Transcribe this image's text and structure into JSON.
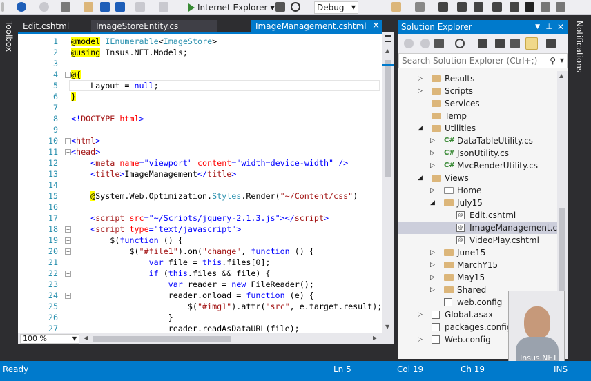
{
  "toolbar": {
    "run_label": "Internet Explorer",
    "config": "Debug"
  },
  "side_panels": {
    "left": "Toolbox",
    "right": "Notifications"
  },
  "tabs": [
    {
      "label": "Edit.cshtml"
    },
    {
      "label": "ImageStoreEntity.cs"
    },
    {
      "label": "ImageManagement.cshtml",
      "active": true
    }
  ],
  "editor": {
    "zoom": "100 %",
    "lines": [
      {
        "n": "1",
        "segs": [
          [
            "@model",
            "#000",
            "#ffff00"
          ],
          [
            " ",
            "#000"
          ],
          [
            "IEnumerable",
            "#2b91af"
          ],
          [
            "<",
            "#000"
          ],
          [
            "ImageStore",
            "#2b91af"
          ],
          [
            ">",
            "#000"
          ]
        ]
      },
      {
        "n": "2",
        "segs": [
          [
            "@using",
            "#000",
            "#ffff00"
          ],
          [
            " Insus.NET.Models;",
            "#000"
          ]
        ]
      },
      {
        "n": "3",
        "segs": []
      },
      {
        "n": "4",
        "fold": "-",
        "segs": [
          [
            "@{",
            "#000",
            "#ffff00"
          ]
        ]
      },
      {
        "n": "5",
        "cur": true,
        "segs": [
          [
            "    Layout = ",
            "#000"
          ],
          [
            "null",
            "#0000ff"
          ],
          [
            ";",
            "#000"
          ]
        ]
      },
      {
        "n": "6",
        "segs": [
          [
            "}",
            "#000",
            "#ffff00"
          ]
        ]
      },
      {
        "n": "7",
        "segs": []
      },
      {
        "n": "8",
        "segs": [
          [
            "<!",
            "#0000ff"
          ],
          [
            "DOCTYPE",
            "#a31515"
          ],
          [
            " ",
            "#000"
          ],
          [
            "html",
            "#ff0000"
          ],
          [
            ">",
            "#0000ff"
          ]
        ]
      },
      {
        "n": "9",
        "segs": []
      },
      {
        "n": "10",
        "fold": "-",
        "segs": [
          [
            "<",
            "#0000ff"
          ],
          [
            "html",
            "#a31515"
          ],
          [
            ">",
            "#0000ff"
          ]
        ]
      },
      {
        "n": "11",
        "fold": "-",
        "segs": [
          [
            "<",
            "#0000ff"
          ],
          [
            "head",
            "#a31515"
          ],
          [
            ">",
            "#0000ff"
          ]
        ]
      },
      {
        "n": "12",
        "segs": [
          [
            "    <",
            "#0000ff"
          ],
          [
            "meta",
            "#a31515"
          ],
          [
            " ",
            "#000"
          ],
          [
            "name",
            "#ff0000"
          ],
          [
            "=",
            "#0000ff"
          ],
          [
            "\"viewport\"",
            "#0000ff"
          ],
          [
            " ",
            "#000"
          ],
          [
            "content",
            "#ff0000"
          ],
          [
            "=",
            "#0000ff"
          ],
          [
            "\"width=device-width\"",
            "#0000ff"
          ],
          [
            " />",
            "#0000ff"
          ]
        ]
      },
      {
        "n": "13",
        "segs": [
          [
            "    <",
            "#0000ff"
          ],
          [
            "title",
            "#a31515"
          ],
          [
            ">",
            "#0000ff"
          ],
          [
            "ImageManagement",
            "#000"
          ],
          [
            "</",
            "#0000ff"
          ],
          [
            "title",
            "#a31515"
          ],
          [
            ">",
            "#0000ff"
          ]
        ]
      },
      {
        "n": "14",
        "segs": []
      },
      {
        "n": "15",
        "segs": [
          [
            "    ",
            "#000"
          ],
          [
            "@",
            "#000",
            "#ffff00"
          ],
          [
            "System.Web.Optimization.",
            "#000"
          ],
          [
            "Styles",
            "#2b91af"
          ],
          [
            ".Render(",
            "#000"
          ],
          [
            "\"~/Content/css\"",
            "#a31515"
          ],
          [
            ")",
            "#000"
          ]
        ]
      },
      {
        "n": "16",
        "segs": []
      },
      {
        "n": "17",
        "segs": [
          [
            "    <",
            "#0000ff"
          ],
          [
            "script",
            "#a31515"
          ],
          [
            " ",
            "#000"
          ],
          [
            "src",
            "#ff0000"
          ],
          [
            "=",
            "#0000ff"
          ],
          [
            "\"~/Scripts/jquery-2.1.3.js\"",
            "#0000ff"
          ],
          [
            "></",
            "#0000ff"
          ],
          [
            "script",
            "#a31515"
          ],
          [
            ">",
            "#0000ff"
          ]
        ]
      },
      {
        "n": "18",
        "fold": "-",
        "segs": [
          [
            "    <",
            "#0000ff"
          ],
          [
            "script",
            "#a31515"
          ],
          [
            " ",
            "#000"
          ],
          [
            "type",
            "#ff0000"
          ],
          [
            "=",
            "#0000ff"
          ],
          [
            "\"text/javascript\"",
            "#0000ff"
          ],
          [
            ">",
            "#0000ff"
          ]
        ]
      },
      {
        "n": "19",
        "fold": "-",
        "segs": [
          [
            "        $(",
            "#000"
          ],
          [
            "function",
            "#0000ff"
          ],
          [
            " () {",
            "#000"
          ]
        ]
      },
      {
        "n": "20",
        "fold": "-",
        "segs": [
          [
            "            $(",
            "#000"
          ],
          [
            "\"#file1\"",
            "#a31515"
          ],
          [
            ").on(",
            "#000"
          ],
          [
            "\"change\"",
            "#a31515"
          ],
          [
            ", ",
            "#000"
          ],
          [
            "function",
            "#0000ff"
          ],
          [
            " () {",
            "#000"
          ]
        ]
      },
      {
        "n": "21",
        "segs": [
          [
            "                ",
            "#000"
          ],
          [
            "var",
            "#0000ff"
          ],
          [
            " file = ",
            "#000"
          ],
          [
            "this",
            "#0000ff"
          ],
          [
            ".files[0];",
            "#000"
          ]
        ]
      },
      {
        "n": "22",
        "fold": "-",
        "segs": [
          [
            "                ",
            "#000"
          ],
          [
            "if",
            "#0000ff"
          ],
          [
            " (",
            "#000"
          ],
          [
            "this",
            "#0000ff"
          ],
          [
            ".files && file) {",
            "#000"
          ]
        ]
      },
      {
        "n": "23",
        "segs": [
          [
            "                    ",
            "#000"
          ],
          [
            "var",
            "#0000ff"
          ],
          [
            " reader = ",
            "#000"
          ],
          [
            "new",
            "#0000ff"
          ],
          [
            " FileReader();",
            "#000"
          ]
        ]
      },
      {
        "n": "24",
        "fold": "-",
        "segs": [
          [
            "                    reader.onload = ",
            "#000"
          ],
          [
            "function",
            "#0000ff"
          ],
          [
            " (e) {",
            "#000"
          ]
        ]
      },
      {
        "n": "25",
        "segs": [
          [
            "                        $(",
            "#000"
          ],
          [
            "\"#img1\"",
            "#a31515"
          ],
          [
            ").attr(",
            "#000"
          ],
          [
            "\"src\"",
            "#a31515"
          ],
          [
            ", e.target.result);",
            "#000"
          ]
        ]
      },
      {
        "n": "26",
        "segs": [
          [
            "                    }",
            "#000"
          ]
        ]
      },
      {
        "n": "27",
        "segs": [
          [
            "                    reader.readAsDataURL(file);",
            "#000"
          ]
        ]
      }
    ]
  },
  "solution_explorer": {
    "title": "Solution Explorer",
    "search_placeholder": "Search Solution Explorer (Ctrl+;)",
    "items": [
      {
        "label": "Results",
        "indent": 1,
        "arrow": "right",
        "icon": "folder"
      },
      {
        "label": "Scripts",
        "indent": 1,
        "arrow": "right",
        "icon": "folder"
      },
      {
        "label": "Services",
        "indent": 1,
        "arrow": "",
        "icon": "folder"
      },
      {
        "label": "Temp",
        "indent": 1,
        "arrow": "",
        "icon": "folder"
      },
      {
        "label": "Utilities",
        "indent": 1,
        "arrow": "down",
        "icon": "folder"
      },
      {
        "label": "DataTableUtility.cs",
        "indent": 2,
        "arrow": "right",
        "icon": "cs"
      },
      {
        "label": "JsonUtility.cs",
        "indent": 2,
        "arrow": "right",
        "icon": "cs"
      },
      {
        "label": "MvcRenderUtility.cs",
        "indent": 2,
        "arrow": "right",
        "icon": "cs"
      },
      {
        "label": "Views",
        "indent": 1,
        "arrow": "down",
        "icon": "folder"
      },
      {
        "label": "Home",
        "indent": 2,
        "arrow": "right",
        "icon": "folder-white"
      },
      {
        "label": "July15",
        "indent": 2,
        "arrow": "down",
        "icon": "folder"
      },
      {
        "label": "Edit.cshtml",
        "indent": 3,
        "arrow": "",
        "icon": "file"
      },
      {
        "label": "ImageManagement.cshtml",
        "indent": 3,
        "arrow": "",
        "icon": "file",
        "selected": true
      },
      {
        "label": "VideoPlay.cshtml",
        "indent": 3,
        "arrow": "",
        "icon": "file"
      },
      {
        "label": "June15",
        "indent": 2,
        "arrow": "right",
        "icon": "folder"
      },
      {
        "label": "MarchY15",
        "indent": 2,
        "arrow": "right",
        "icon": "folder"
      },
      {
        "label": "May15",
        "indent": 2,
        "arrow": "right",
        "icon": "folder"
      },
      {
        "label": "Shared",
        "indent": 2,
        "arrow": "right",
        "icon": "folder"
      },
      {
        "label": "web.config",
        "indent": 2,
        "arrow": "",
        "icon": "config"
      },
      {
        "label": "Global.asax",
        "indent": 1,
        "arrow": "right",
        "icon": "config"
      },
      {
        "label": "packages.config",
        "indent": 1,
        "arrow": "",
        "icon": "config"
      },
      {
        "label": "Web.config",
        "indent": 1,
        "arrow": "right",
        "icon": "config"
      }
    ]
  },
  "status": {
    "ready": "Ready",
    "ln": "Ln 5",
    "col": "Col 19",
    "ch": "Ch 19",
    "mode": "INS"
  },
  "webcam_label": "Insus.NET",
  "colors": {
    "accent": "#007acc",
    "chrome": "#2d2d30"
  }
}
